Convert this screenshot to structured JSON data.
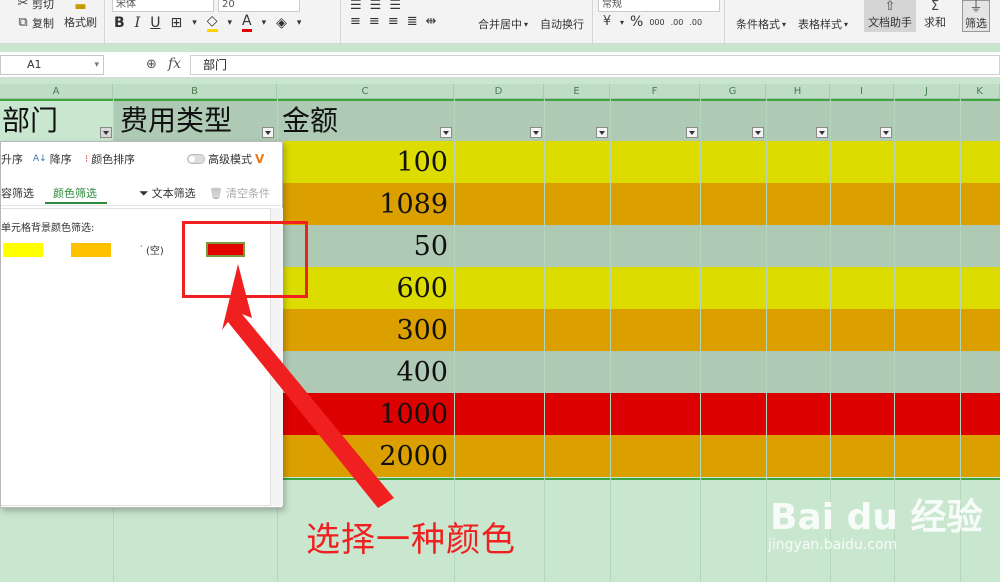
{
  "ribbon": {
    "cut_label": "剪切",
    "copy_label": "复制",
    "format_painter_label": "格式刷",
    "font_name": "宋体",
    "font_size": "20",
    "merge_center_label": "合并居中",
    "wrap_text_label": "自动换行",
    "number_format": "常规",
    "percent_label": "%",
    "thousands_label": "000",
    "inc_decimal_label": ".00",
    "dec_decimal_label": ".00",
    "cond_format_label": "条件格式",
    "table_style_label": "表格样式",
    "doc_helper_label": "文档助手",
    "sum_label": "求和",
    "filter_label": "筛选"
  },
  "formula_bar": {
    "name_box": "A1",
    "fx_label": "fx",
    "content": "部门"
  },
  "columns": [
    "A",
    "B",
    "C",
    "D",
    "E",
    "F",
    "G",
    "H",
    "I",
    "J",
    "K"
  ],
  "sheet": {
    "headers": {
      "a": "部门",
      "b": "费用类型",
      "c": "金额"
    },
    "rows": [
      {
        "amount": "100",
        "color": "#dcdc00"
      },
      {
        "amount": "1089",
        "color": "#dba000"
      },
      {
        "amount": "50",
        "color": "#aecab4"
      },
      {
        "amount": "600",
        "color": "#dcdc00"
      },
      {
        "amount": "300",
        "color": "#dba000"
      },
      {
        "amount": "400",
        "color": "#aecab4"
      },
      {
        "amount": "1000",
        "color": "#dd0000"
      },
      {
        "amount": "2000",
        "color": "#dba000"
      }
    ],
    "header_row_color": "#aecab4",
    "empty_color": "#c9e6cf"
  },
  "filter_panel": {
    "sort_asc_label": "升序",
    "sort_desc_label": "降序",
    "sort_color_label": "颜色排序",
    "advanced_mode_label": "高级模式",
    "content_filter_tab": "容筛选",
    "color_filter_tab": "颜色筛选",
    "text_filter_label": "文本筛选",
    "clear_label": "清空条件",
    "bg_color_filter_label": "单元格背景颜色筛选:",
    "empty_label": "(空)",
    "swatches": [
      "#ffff00",
      "#ffc000",
      "#e00000"
    ]
  },
  "annotation": {
    "text": "选择一种颜色",
    "color": "#f02020"
  },
  "watermark": {
    "logo": "Bai du 经验",
    "url": "jingyan.baidu.com"
  }
}
